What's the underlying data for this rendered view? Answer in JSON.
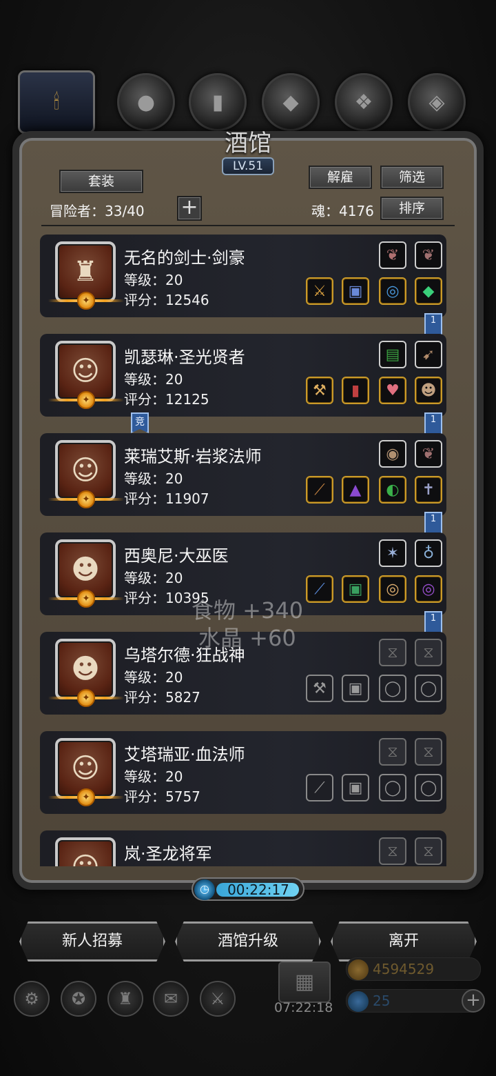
{
  "header": {
    "title": "酒馆",
    "level": "LV.51",
    "tabs": [
      "candle-icon",
      "bag-icon",
      "wood-icon",
      "ingot-icon",
      "feather-icon",
      "anvil-icon"
    ]
  },
  "toolbar": {
    "outfit_label": "套装",
    "dismiss_label": "解雇",
    "filter_label": "筛选",
    "sort_label": "排序",
    "adventurers": "冒险者：33/40",
    "add_label": "+",
    "soul": "魂：4176"
  },
  "heroes": [
    {
      "name": "无名的剑士·剑豪",
      "level": "等级：20",
      "score": "评分：12546",
      "top_slots": [
        "feather",
        "feather"
      ],
      "bottom_slots": [
        "sword",
        "armor",
        "necklace",
        "gem"
      ],
      "badge": "1",
      "empty": false
    },
    {
      "name": "凯瑟琳·圣光贤者",
      "level": "等级：20",
      "score": "评分：12125",
      "top_slots": [
        "book",
        "horn"
      ],
      "bottom_slots": [
        "hammer",
        "robe",
        "heart",
        "mask"
      ],
      "badge": "1",
      "empty": false,
      "tag": "竞"
    },
    {
      "name": "莱瑞艾斯·岩浆法师",
      "level": "等级：20",
      "score": "评分：11907",
      "top_slots": [
        "shell",
        "feather"
      ],
      "bottom_slots": [
        "staff",
        "helmet",
        "pendant",
        "cross"
      ],
      "badge": "1",
      "empty": false
    },
    {
      "name": "西奥尼·大巫医",
      "level": "等级：20",
      "score": "评分：10395",
      "top_slots": [
        "amulet",
        "pendant"
      ],
      "bottom_slots": [
        "wand",
        "armor",
        "ring",
        "ring"
      ],
      "badge": "1",
      "empty": false
    },
    {
      "name": "乌塔尔德·狂战神",
      "level": "等级：20",
      "score": "评分：5827",
      "top_slots": [
        "hourglass",
        "hourglass"
      ],
      "bottom_slots": [
        "axe",
        "armor",
        "ring",
        "ring"
      ],
      "empty": true
    },
    {
      "name": "艾塔瑞亚·血法师",
      "level": "等级：20",
      "score": "评分：5757",
      "top_slots": [
        "hourglass",
        "hourglass"
      ],
      "bottom_slots": [
        "staff",
        "armor",
        "ring",
        "ring"
      ],
      "empty": true
    },
    {
      "name": "岚·圣龙将军",
      "level": "",
      "score": "",
      "top_slots": [
        "hourglass",
        "hourglass"
      ],
      "bottom_slots": [],
      "empty": true
    }
  ],
  "floating": {
    "food": "食物 +340",
    "crystal": "水晶 +60"
  },
  "timer": "00:22:17",
  "bottom_buttons": {
    "recruit": "新人招募",
    "upgrade": "酒馆升级",
    "leave": "离开"
  },
  "bottom_bar": {
    "gift_timer": "07:22:18",
    "gold": "4594529",
    "gems": "25",
    "icons": [
      "gear-icon",
      "star-icon",
      "helmet-icon",
      "mail-icon",
      "swords-icon"
    ]
  },
  "colors": {
    "frame": "#5a5040",
    "accent_gold": "#e8a020",
    "flag_blue": "#2f5a9a"
  }
}
